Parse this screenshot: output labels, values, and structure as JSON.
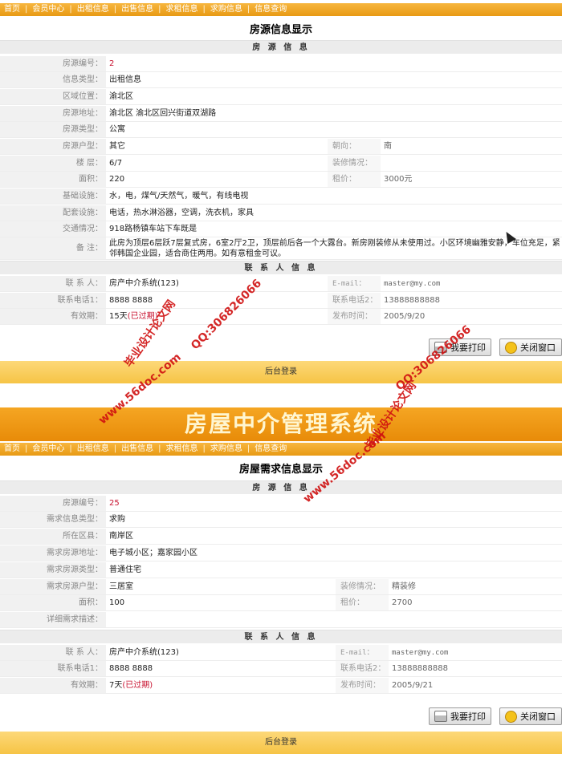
{
  "nav": [
    "首页",
    "会员中心",
    "出租信息",
    "出售信息",
    "求租信息",
    "求购信息",
    "信息查询"
  ],
  "top": {
    "title": "房源信息显示",
    "section1": "房 源 信 息",
    "rows": [
      {
        "label": "房源编号：",
        "value": "2"
      },
      {
        "label": "信息类型：",
        "value": "出租信息"
      },
      {
        "label": "区域位置：",
        "value": "渝北区"
      },
      {
        "label": "房源地址：",
        "value": "渝北区 渝北区回兴街道双湖路"
      },
      {
        "label": "房源类型：",
        "value": "公寓"
      }
    ],
    "huxing_label": "房源户型：",
    "huxing": "其它",
    "chaoxiang_label": "朝向：",
    "chaoxiang": "南",
    "louceng_label": "楼 层：",
    "louceng": "6/7",
    "zhuangxiu_label": "装修情况：",
    "zhuangxiu": "",
    "mianji_label": "面积：",
    "mianji": "220",
    "zujia_label": "租价：",
    "zujia": "3000元",
    "rows2": [
      {
        "label": "基础设施：",
        "value": "水，电，煤气/天然气，暖气，有线电视"
      },
      {
        "label": "配套设施：",
        "value": "电话，热水淋浴器，空调，洗衣机，家具"
      },
      {
        "label": "交通情况：",
        "value": "918路杨镇车站下车既是"
      }
    ],
    "beizhu_label": "备 注：",
    "beizhu": "此房为顶层6层跃7层复式房，6室2厅2卫，顶层前后各一个大露台。新房刚装修从未使用过。小区环境幽雅安静，车位充足，紧邻韩国企业园，适合商住两用。如有意租金可议。",
    "section2": "联 系 人 信 息",
    "contact_label": "联 系 人：",
    "contact": "房产中介系统(123)",
    "email_label": "E-mail：",
    "email": "master@my.com",
    "tel1_label": "联系电话1：",
    "tel1": "8888 8888",
    "tel2_label": "联系电话2：",
    "tel2": "13888888888",
    "valid_label": "有效期：",
    "valid": "15天",
    "expired": "(已过期)",
    "pub_label": "发布时间：",
    "pub": "2005/9/20",
    "print_btn": "我要打印",
    "close_btn": "关闭窗口",
    "footer": "后台登录"
  },
  "banner": "房屋中介管理系统",
  "bottom": {
    "title": "房屋需求信息显示",
    "section1": "房 源 信 息",
    "rows": [
      {
        "label": "房源编号：",
        "value": "25",
        "red": true
      },
      {
        "label": "需求信息类型：",
        "value": "求购"
      },
      {
        "label": "所在区县：",
        "value": "南岸区"
      },
      {
        "label": "需求房源地址：",
        "value": "电子城小区；嘉家园小区"
      },
      {
        "label": "需求房源类型：",
        "value": "普通住宅"
      }
    ],
    "huxing_label": "需求房源户型：",
    "huxing": "三居室",
    "zhuangxiu_label": "装修情况：",
    "zhuangxiu": "精装修",
    "mianji_label": "面积：",
    "mianji": "100",
    "zujia_label": "租价：",
    "zujia": "2700",
    "desc_label": "详细需求描述：",
    "desc": "",
    "section2": "联 系 人 信 息",
    "contact_label": "联 系 人：",
    "contact": "房产中介系统(123)",
    "email_label": "E-mail：",
    "email": "master@my.com",
    "tel1_label": "联系电话1：",
    "tel1": "8888 8888",
    "tel2_label": "联系电话2：",
    "tel2": "13888888888",
    "valid_label": "有效期：",
    "valid": "7天",
    "expired": "(已过期)",
    "pub_label": "发布时间：",
    "pub": "2005/9/21",
    "print_btn": "我要打印",
    "close_btn": "关闭窗口",
    "footer": "后台登录"
  },
  "watermarks": [
    "毕业设计论文网",
    "www.56doc.com",
    "QQ:306826066"
  ]
}
